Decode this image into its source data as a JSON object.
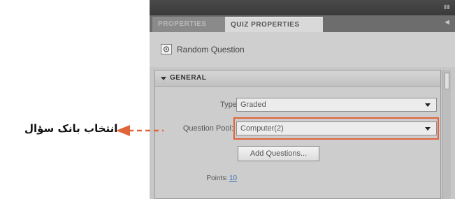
{
  "panel": {
    "tabs": [
      {
        "label": "PROPERTIES",
        "active": false
      },
      {
        "label": "QUIZ PROPERTIES",
        "active": true
      }
    ],
    "collapse_glyph": "◄",
    "object_title": "Random Question",
    "object_icon": "random-question-icon"
  },
  "section": {
    "title": "GENERAL",
    "expanded": true,
    "fields": {
      "type_label": "Type:",
      "type_value": "Graded",
      "pool_label": "Question Pool:",
      "pool_value": "Computer(2)",
      "add_button": "Add Questions...",
      "points_label": "Points:",
      "points_value": "10"
    }
  },
  "annotation": {
    "text": "انتخاب بانک سؤال",
    "color": "#e0653a"
  },
  "colors": {
    "accent": "#e0653a",
    "link": "#3e6fb5",
    "topbar": "#3f3f3f"
  }
}
